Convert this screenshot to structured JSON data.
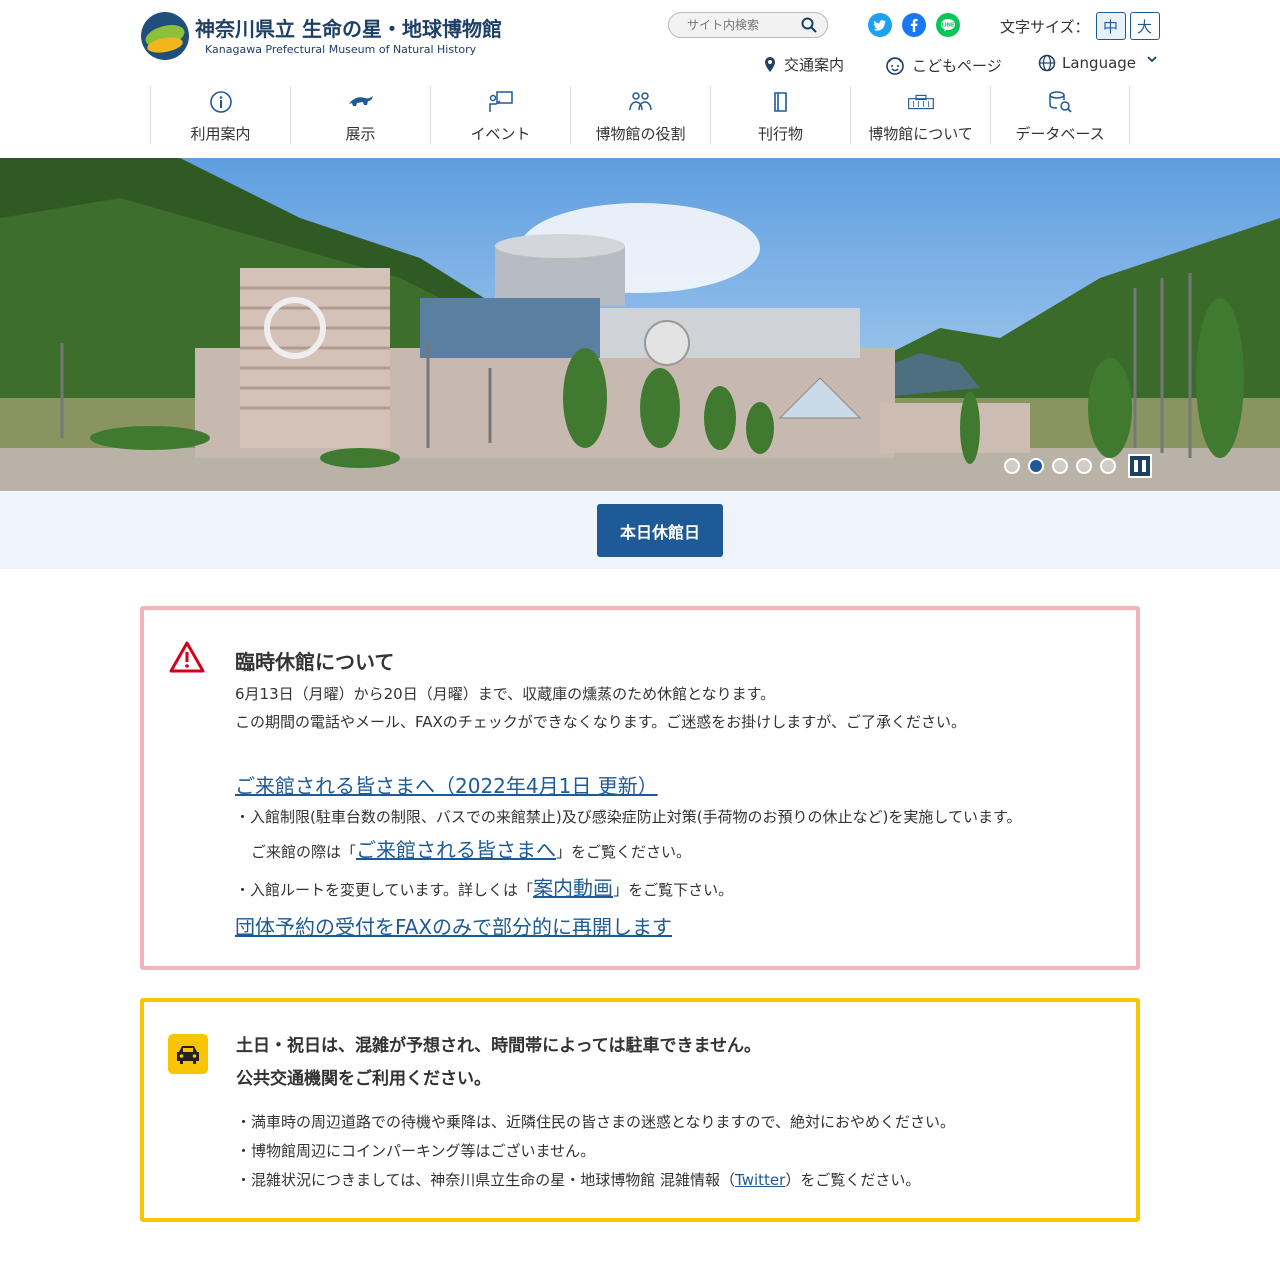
{
  "header": {
    "logo_jp": "神奈川県立 生命の星・地球博物館",
    "logo_en": "Kanagawa Prefectural Museum of Natural History",
    "search_placeholder": "サイト内検索",
    "font_size_label": "文字サイズ：",
    "font_size_medium": "中",
    "font_size_large": "大",
    "access_label": "交通案内",
    "kids_label": "こどもページ",
    "language_label": "Language"
  },
  "nav": {
    "items": [
      {
        "label": "利用案内",
        "icon": "info-icon"
      },
      {
        "label": "展示",
        "icon": "dinosaur-icon"
      },
      {
        "label": "イベント",
        "icon": "presentation-icon"
      },
      {
        "label": "博物館の役割",
        "icon": "people-icon"
      },
      {
        "label": "刊行物",
        "icon": "book-icon"
      },
      {
        "label": "博物館について",
        "icon": "building-icon"
      },
      {
        "label": "データベース",
        "icon": "database-search-icon"
      }
    ]
  },
  "hero": {
    "slide_count": 5,
    "active_slide": 2
  },
  "status": {
    "closed_today": "本日休館日"
  },
  "notice_red": {
    "title": "臨時休館について",
    "line1": "6月13日（月曜）から20日（月曜）まで、収蔵庫の燻蒸のため休館となります。",
    "line2": "この期間の電話やメール、FAXのチェックができなくなります。ご迷惑をお掛けしますが、ご了承ください。",
    "visitor_link": "ご来館される皆さまへ（2022年4月1日 更新）",
    "bullet1": "・入館制限(駐車台数の制限、バスでの来館禁止)及び感染症防止対策(手荷物のお預りの休止など)を実施しています。",
    "bullet1b_pre": "ご来館の際は「",
    "bullet1b_link": "ご来館される皆さまへ",
    "bullet1b_post": "」をご覧ください。",
    "bullet2_pre": "・入館ルートを変更しています。詳しくは「",
    "bullet2_link": "案内動画",
    "bullet2_post": "」をご覧下さい。",
    "group_link": "団体予約の受付をFAXのみで部分的に再開します"
  },
  "notice_yellow": {
    "title1": "土日・祝日は、混雑が予想され、時間帯によっては駐車できません。",
    "title2": "公共交通機関をご利用ください。",
    "bullet1": "・満車時の周辺道路での待機や乗降は、近隣住民の皆さまの迷惑となりますので、絶対におやめください。",
    "bullet2": "・博物館周辺にコインパーキング等はございません。",
    "bullet3_pre": "・混雑状況につきましては、神奈川県立生命の星・地球博物館 混雑情報（",
    "bullet3_link": "Twitter",
    "bullet3_post": "）をご覧ください。"
  },
  "colors": {
    "accent": "#1e5a96",
    "notice_red_border": "#f3b3bb",
    "notice_yellow_border": "#f9c400",
    "warning_red": "#d0021b"
  }
}
